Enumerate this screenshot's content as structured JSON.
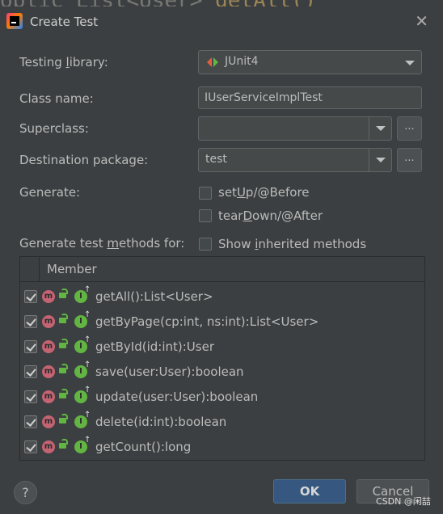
{
  "bg_code": {
    "before": "oblic List<User> ",
    "fn": "getAll() {"
  },
  "dialog": {
    "title": "Create Test"
  },
  "form": {
    "testing_library_label": "Testing library:",
    "testing_library_value": "JUnit4",
    "class_name_label": "Class name:",
    "class_name_value": "IUserServiceImplTest",
    "superclass_label": "Superclass:",
    "superclass_value": "",
    "dest_pkg_label": "Destination package:",
    "dest_pkg_value": "test",
    "browse_label": "...",
    "generate_label": "Generate:",
    "setup_label": "setUp/@Before",
    "teardown_label": "tearDown/@After",
    "methods_label": "Generate test methods for:",
    "show_inherited_label": "Show inherited methods"
  },
  "table": {
    "header": "Member",
    "rows": [
      {
        "method": "getAll():List<User>",
        "checked": true
      },
      {
        "method": "getByPage(cp:int, ns:int):List<User>",
        "checked": true
      },
      {
        "method": "getById(id:int):User",
        "checked": true
      },
      {
        "method": "save(user:User):boolean",
        "checked": true
      },
      {
        "method": "update(user:User):boolean",
        "checked": true
      },
      {
        "method": "delete(id:int):boolean",
        "checked": true
      },
      {
        "method": "getCount():long",
        "checked": true
      }
    ],
    "m_letter": "m",
    "i_letter": "I"
  },
  "buttons": {
    "help": "?",
    "ok": "OK",
    "cancel": "Cancel"
  },
  "watermark": "CSDN @闲喆",
  "colors": {
    "accent": "#365880",
    "method_icon": "#c46372",
    "interface_icon": "#62b543",
    "bg": "#3c3f41"
  }
}
